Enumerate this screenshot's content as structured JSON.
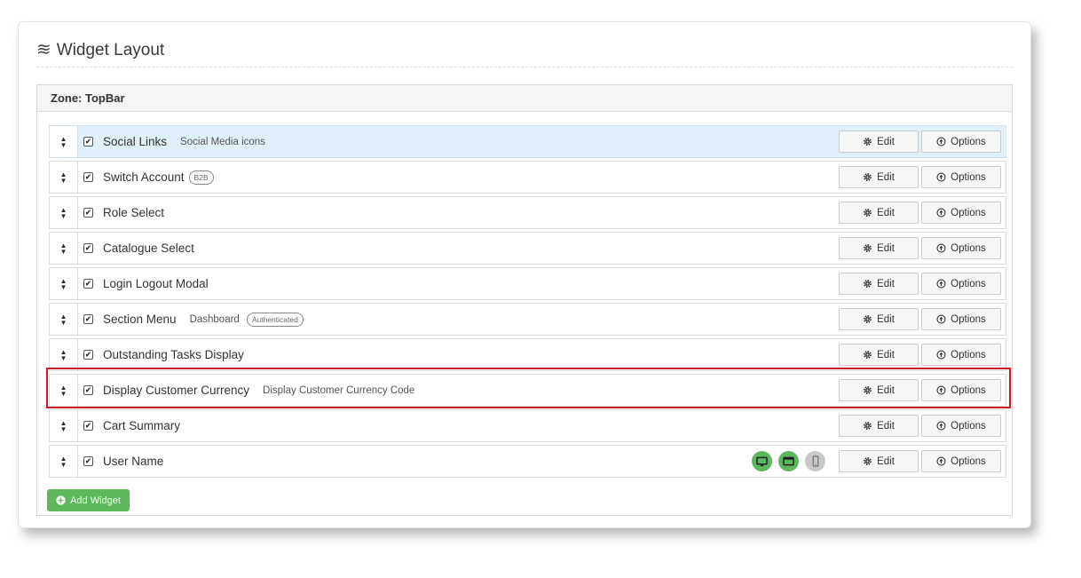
{
  "page": {
    "icon": "wavy-lines-icon",
    "title": "Widget Layout"
  },
  "zone": {
    "label": "Zone: TopBar"
  },
  "buttons": {
    "edit_label": "Edit",
    "edit_icon": "gear-icon",
    "options_label": "Options",
    "options_icon": "circle-arrow-up-icon",
    "add_widget_label": "Add Widget",
    "add_widget_icon": "plus-circle-icon"
  },
  "widgets": [
    {
      "name": "Social Links",
      "description": "Social Media icons",
      "checked": true,
      "highlighted": true
    },
    {
      "name": "Switch Account",
      "badge": "B2B",
      "checked": true
    },
    {
      "name": "Role Select",
      "checked": true
    },
    {
      "name": "Catalogue Select",
      "checked": true
    },
    {
      "name": "Login Logout Modal",
      "checked": true
    },
    {
      "name": "Section Menu",
      "description": "Dashboard",
      "badge": "Authenticated",
      "checked": true
    },
    {
      "name": "Outstanding Tasks Display",
      "checked": true
    },
    {
      "name": "Display Customer Currency",
      "description": "Display Customer Currency Code",
      "checked": true,
      "outlined": true
    },
    {
      "name": "Cart Summary",
      "checked": true
    },
    {
      "name": "User Name",
      "checked": true,
      "devices": [
        {
          "icon": "desktop-icon",
          "enabled": true
        },
        {
          "icon": "tablet-icon",
          "enabled": true
        },
        {
          "icon": "mobile-icon",
          "enabled": false
        }
      ]
    }
  ],
  "colors": {
    "highlight_row": "#dff0fb",
    "outline": "#c8202a",
    "device_on": "#5cb85c",
    "device_off": "#c8c8c8",
    "add_button": "#5cb85c"
  }
}
